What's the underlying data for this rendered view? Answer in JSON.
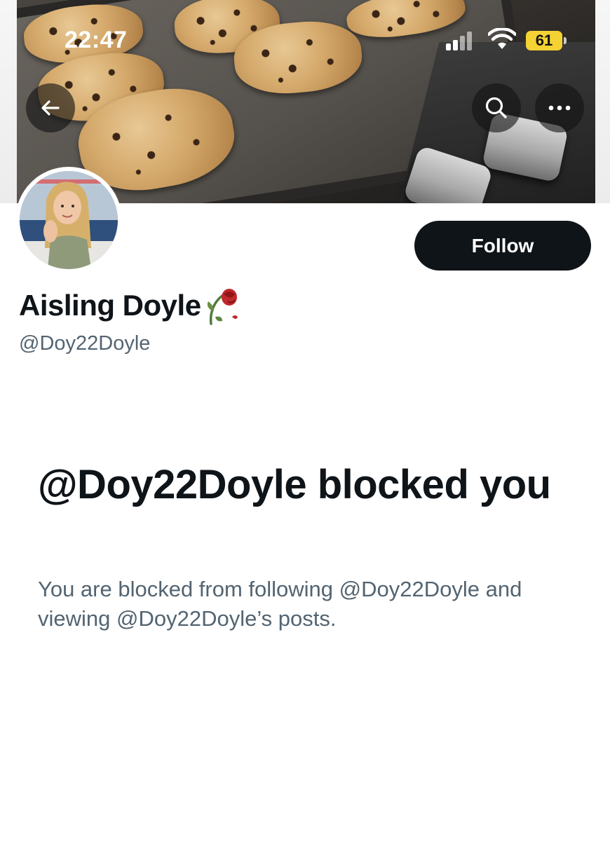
{
  "status_bar": {
    "time": "22:47",
    "battery": "61",
    "battery_color": "#f5d234"
  },
  "header": {
    "back_icon": "arrow-left-icon",
    "search_icon": "search-icon",
    "more_icon": "more-horizontal-icon"
  },
  "profile": {
    "display_name": "Aisling Doyle",
    "name_emoji_icon": "wilted-rose-icon",
    "handle": "@Doy22Doyle",
    "follow_label": "Follow"
  },
  "blocked": {
    "title": "@Doy22Doyle blocked you",
    "message": "You are blocked from following @Doy22Doyle and viewing @Doy22Doyle’s posts."
  },
  "colors": {
    "primary_text": "#0f1419",
    "secondary_text": "#536471",
    "follow_button_bg": "#0f1419"
  }
}
